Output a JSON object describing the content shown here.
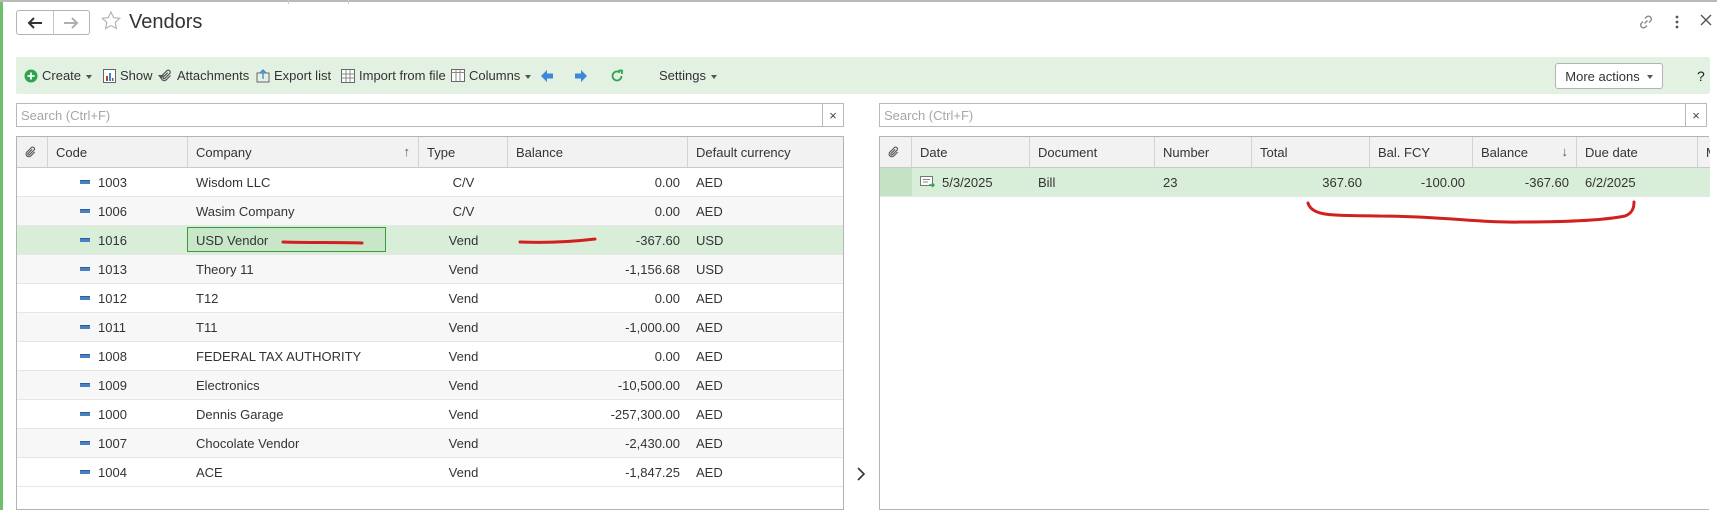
{
  "window": {
    "title": "Vendors"
  },
  "toolbar": {
    "create": "Create",
    "show": "Show",
    "attachments": "Attachments",
    "export": "Export list",
    "import": "Import from file",
    "columns": "Columns",
    "settings": "Settings",
    "more_actions": "More actions",
    "help": "?"
  },
  "left": {
    "search_placeholder": "Search (Ctrl+F)",
    "clear": "×",
    "headers": [
      "Code",
      "Company",
      "Type",
      "Balance",
      "Default currency"
    ],
    "rows": [
      {
        "code": "1003",
        "company": "Wisdom LLC",
        "type": "C/V",
        "balance": "0.00",
        "currency": "AED"
      },
      {
        "code": "1006",
        "company": "Wasim Company",
        "type": "C/V",
        "balance": "0.00",
        "currency": "AED"
      },
      {
        "code": "1016",
        "company": "USD Vendor",
        "type": "Vend",
        "balance": "-367.60",
        "currency": "USD"
      },
      {
        "code": "1013",
        "company": "Theory 11",
        "type": "Vend",
        "balance": "-1,156.68",
        "currency": "USD"
      },
      {
        "code": "1012",
        "company": "T12",
        "type": "Vend",
        "balance": "0.00",
        "currency": "AED"
      },
      {
        "code": "1011",
        "company": "T11",
        "type": "Vend",
        "balance": "-1,000.00",
        "currency": "AED"
      },
      {
        "code": "1008",
        "company": "FEDERAL TAX AUTHORITY",
        "type": "Vend",
        "balance": "0.00",
        "currency": "AED"
      },
      {
        "code": "1009",
        "company": "Electronics",
        "type": "Vend",
        "balance": "-10,500.00",
        "currency": "AED"
      },
      {
        "code": "1000",
        "company": "Dennis Garage",
        "type": "Vend",
        "balance": "-257,300.00",
        "currency": "AED"
      },
      {
        "code": "1007",
        "company": "Chocolate Vendor",
        "type": "Vend",
        "balance": "-2,430.00",
        "currency": "AED"
      },
      {
        "code": "1004",
        "company": "ACE",
        "type": "Vend",
        "balance": "-1,847.25",
        "currency": "AED"
      }
    ]
  },
  "right": {
    "search_placeholder": "Search (Ctrl+F)",
    "clear": "×",
    "headers": [
      "Date",
      "Document",
      "Number",
      "Total",
      "Bal. FCY",
      "Balance",
      "Due date",
      "M"
    ],
    "rows": [
      {
        "date": "5/3/2025",
        "document": "Bill",
        "number": "23",
        "total": "367.60",
        "bal_fcy": "-100.00",
        "balance": "-367.60",
        "due": "6/2/2025"
      }
    ]
  },
  "colors": {
    "toolbar_bg": "#e2f1e2",
    "selected_row": "#d9eed9",
    "annotation": "#d21f1f",
    "accent_blue": "#3d87d6",
    "accent_green": "#2fa44f"
  }
}
